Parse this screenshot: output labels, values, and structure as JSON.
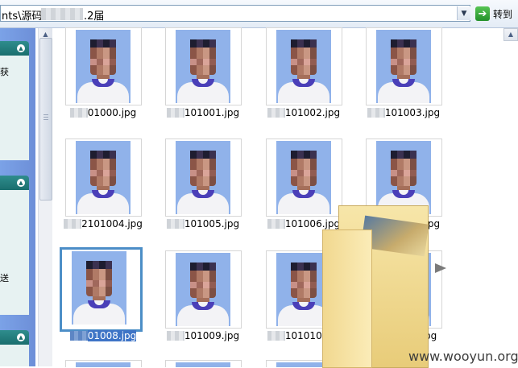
{
  "address_bar": {
    "path_start": "nts\\源码",
    "path_end": ".2届",
    "go_label": "转到"
  },
  "left_pane": {
    "chars": [
      "获",
      "送"
    ]
  },
  "files": [
    {
      "suffix": "01000.jpg",
      "selected": false
    },
    {
      "suffix": "101001.jpg",
      "selected": false
    },
    {
      "suffix": "101002.jpg",
      "selected": false
    },
    {
      "suffix": "101003.jpg",
      "selected": false
    },
    {
      "suffix": "2101004.jpg",
      "selected": false
    },
    {
      "suffix": "101005.jpg",
      "selected": false
    },
    {
      "suffix": "101006.jpg",
      "selected": false
    },
    {
      "suffix": "101007.jpg",
      "selected": false
    },
    {
      "suffix": "01008.jpg",
      "selected": true
    },
    {
      "suffix": "101009.jpg",
      "selected": false
    },
    {
      "suffix": "101010.jpg",
      "selected": false
    },
    {
      "suffix": "01011.jpg",
      "selected": false
    }
  ],
  "watermark": "www.wooyun.org",
  "icons": {
    "go": "green-arrow-right-icon",
    "dropdown": "chevron-down-icon",
    "panel_toggle": "chevron-up-icon"
  }
}
